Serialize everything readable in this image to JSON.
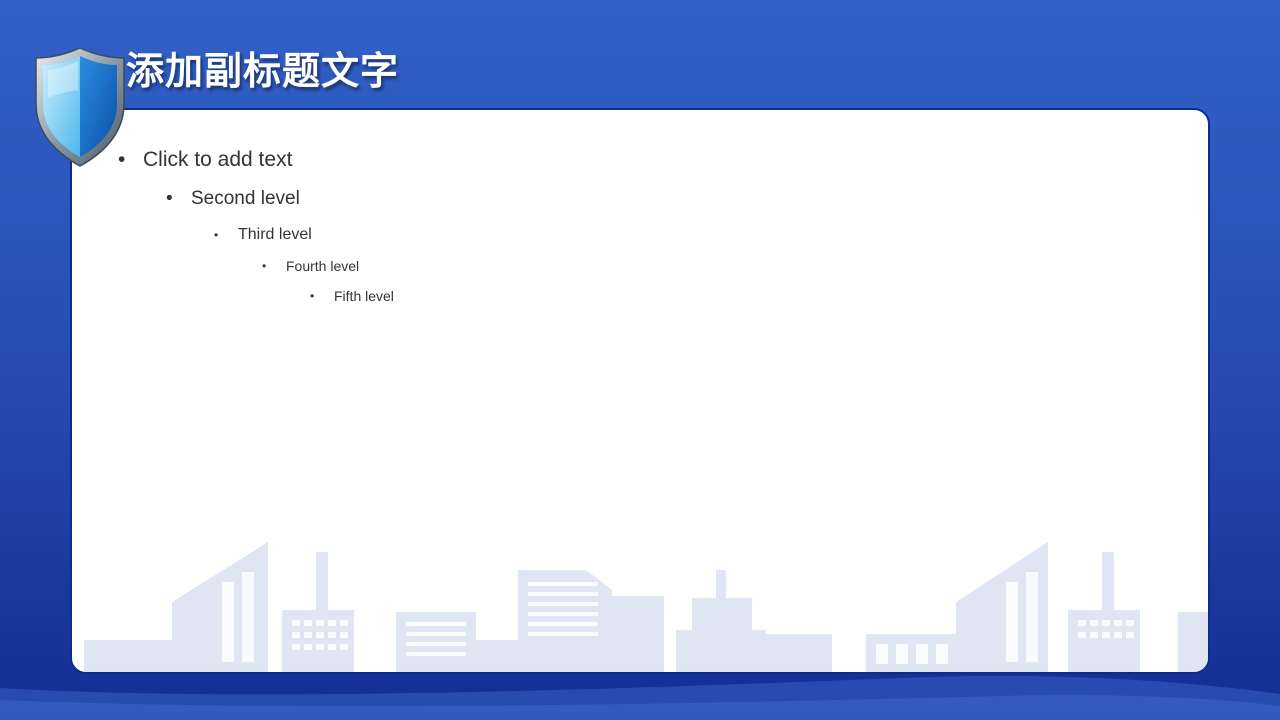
{
  "slide": {
    "title": "添加副标题文字",
    "bullets": {
      "level1": "Click to add text",
      "level2": "Second level",
      "level3": "Third level",
      "level4": "Fourth level",
      "level5": "Fifth level"
    },
    "bullet_glyph": "•"
  },
  "colors": {
    "background_top": "#3160c6",
    "background_bottom": "#132d93",
    "panel": "#ffffff",
    "panel_border": "#0e2a8a",
    "shield_light": "#8fd8f5",
    "shield_dark": "#1a6fd0",
    "building_tint": "#dfe5f3",
    "text": "#333333"
  }
}
